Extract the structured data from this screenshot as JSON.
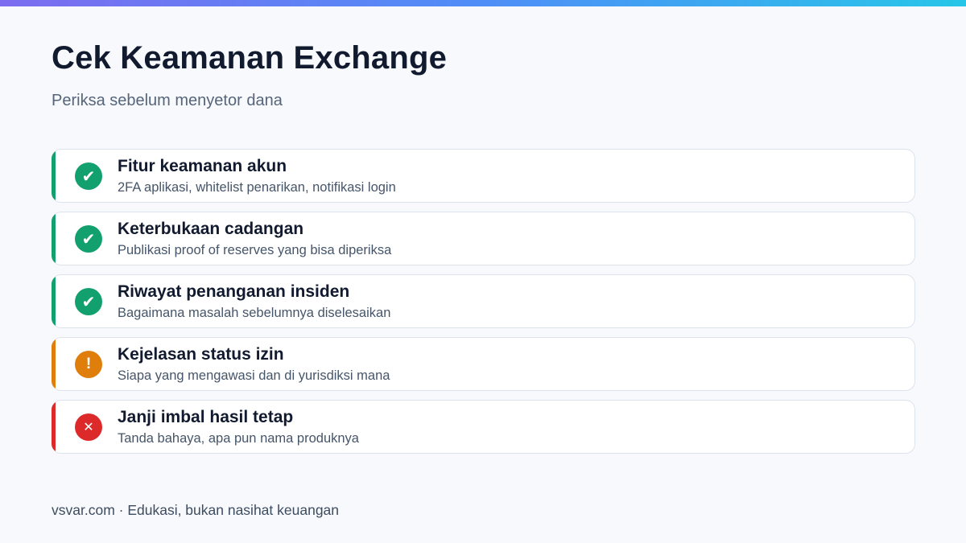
{
  "header": {
    "title": "Cek Keamanan Exchange",
    "subtitle": "Periksa sebelum menyetor dana"
  },
  "checklist": [
    {
      "status": "ok",
      "icon": "check-icon",
      "symbol": "✔",
      "title": "Fitur keamanan akun",
      "description": "2FA aplikasi, whitelist penarikan, notifikasi login"
    },
    {
      "status": "ok",
      "icon": "check-icon",
      "symbol": "✔",
      "title": "Keterbukaan cadangan",
      "description": "Publikasi proof of reserves yang bisa diperiksa"
    },
    {
      "status": "ok",
      "icon": "check-icon",
      "symbol": "✔",
      "title": "Riwayat penanganan insiden",
      "description": "Bagaimana masalah sebelumnya diselesaikan"
    },
    {
      "status": "warn",
      "icon": "exclamation-icon",
      "symbol": "!",
      "title": "Kejelasan status izin",
      "description": "Siapa yang mengawasi dan di yurisdiksi mana"
    },
    {
      "status": "bad",
      "icon": "cross-icon",
      "symbol": "✕",
      "title": "Janji imbal hasil tetap",
      "description": "Tanda bahaya, apa pun nama produknya"
    }
  ],
  "footer": {
    "text": "vsvar.com · Edukasi, bukan nasihat keuangan"
  },
  "colors": {
    "ok": "#12a06e",
    "warn": "#e07e0c",
    "bad": "#dc2a2a",
    "gradient": [
      "#7c6cf0",
      "#4f8ef7",
      "#27c6e8"
    ]
  }
}
